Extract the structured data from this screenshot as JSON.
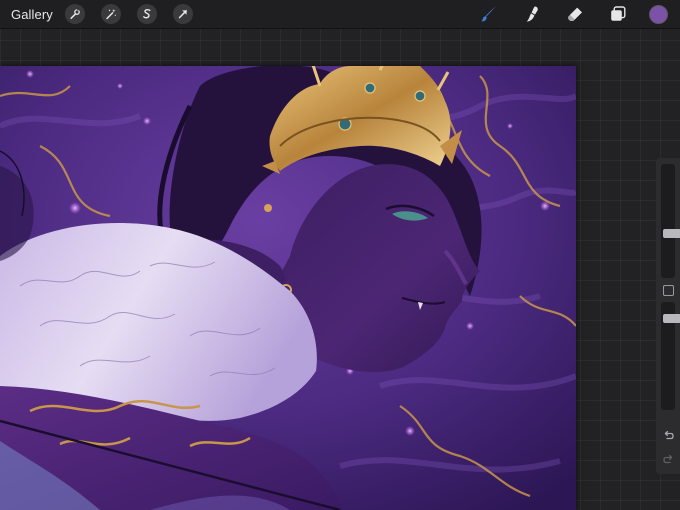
{
  "toolbar": {
    "gallery_label": "Gallery",
    "left_tools": [
      "wrench-icon",
      "magic-wand-icon",
      "selection-s-icon",
      "transform-arrow-icon"
    ],
    "right_tools": [
      "brush-icon",
      "smudge-icon",
      "eraser-icon",
      "layers-icon"
    ],
    "active_tool": "brush-icon",
    "active_color": "#7b52a8",
    "brush_color": "#3d7fd6"
  },
  "sidebar": {
    "brush_size": 0.38,
    "brush_opacity": 0.88
  },
  "colors": {
    "canvas_bg": "#222224",
    "toolbar_bg": "#1f1f21",
    "artwork_base": "#4a2a7a"
  }
}
